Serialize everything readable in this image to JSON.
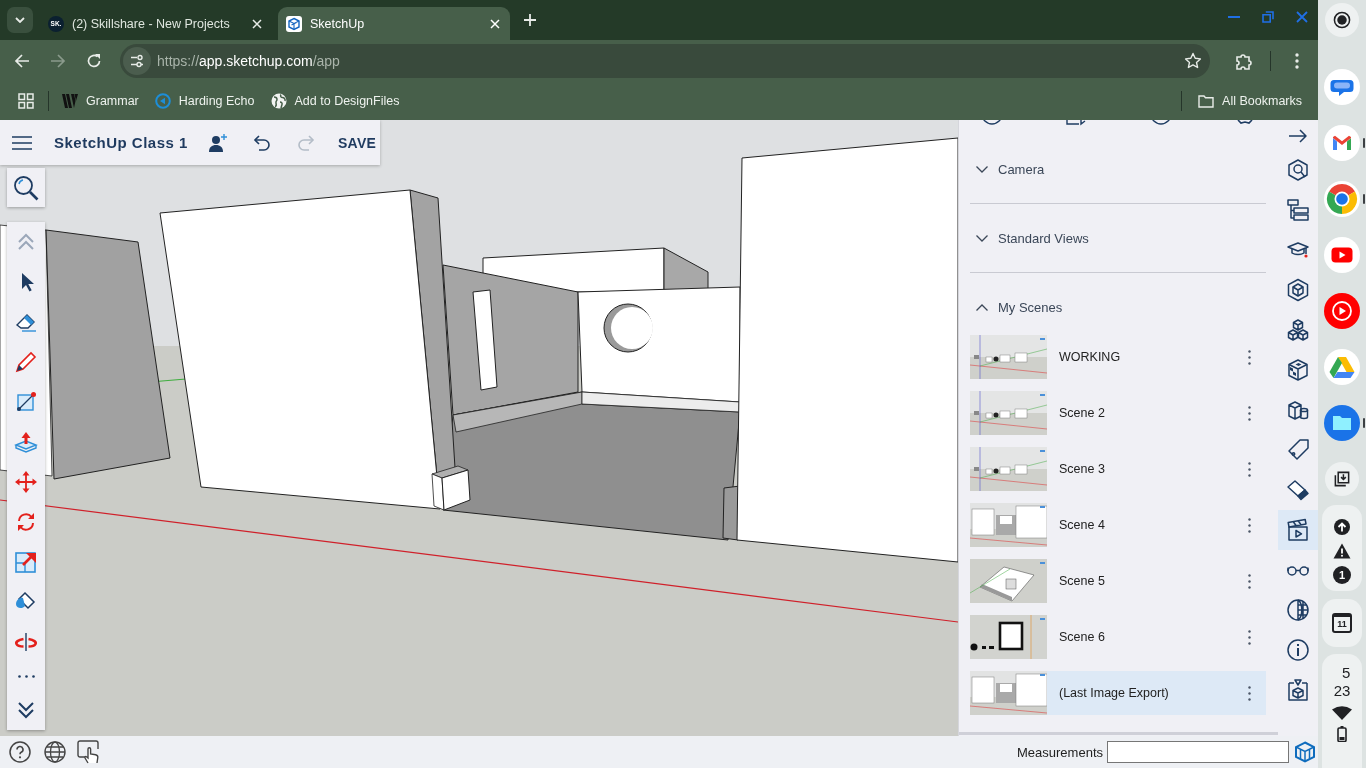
{
  "browser": {
    "tabs": [
      {
        "favicon": "SK.",
        "title": "(2) Skillshare - New Projects",
        "selected": false
      },
      {
        "title": "SketchUp",
        "selected": true
      }
    ],
    "forward_disabled": true,
    "address": {
      "scheme": "https://",
      "host": "app.sketchup.com",
      "path": "/app"
    },
    "bookmarks": [
      {
        "kind": "grammar",
        "label": "Grammar"
      },
      {
        "kind": "echo",
        "label": "Harding Echo"
      },
      {
        "kind": "globe",
        "label": "Add to DesignFiles"
      }
    ],
    "all_bookmarks": "All Bookmarks"
  },
  "app": {
    "title": "SketchUp Class 1",
    "redo_disabled": true,
    "save": "SAVE",
    "tools": [
      {
        "kind": "up",
        "disabled": true
      },
      {
        "kind": "select",
        "disabled": false
      },
      {
        "kind": "eraser",
        "disabled": false
      },
      {
        "kind": "pencil",
        "disabled": false
      },
      {
        "kind": "line",
        "disabled": false
      },
      {
        "kind": "pushpull",
        "disabled": false
      },
      {
        "kind": "move",
        "disabled": false
      },
      {
        "kind": "rotate",
        "disabled": false
      },
      {
        "kind": "scale",
        "disabled": false
      },
      {
        "kind": "paint",
        "disabled": false
      },
      {
        "kind": "orbit",
        "disabled": false
      },
      {
        "kind": "more",
        "disabled": false
      },
      {
        "kind": "down",
        "disabled": false
      }
    ],
    "panel": {
      "sections": [
        {
          "title": "Camera",
          "expanded": false
        },
        {
          "title": "Standard Views",
          "expanded": false
        },
        {
          "title": "My Scenes",
          "expanded": true
        }
      ],
      "scenes": [
        {
          "name": "WORKING",
          "kind": "distant",
          "selected": false
        },
        {
          "name": "Scene 2",
          "kind": "distant",
          "selected": false
        },
        {
          "name": "Scene 3",
          "kind": "distant",
          "selected": false
        },
        {
          "name": "Scene 4",
          "kind": "closeup",
          "selected": false
        },
        {
          "name": "Scene 5",
          "kind": "overhead",
          "selected": false
        },
        {
          "name": "Scene 6",
          "kind": "plan",
          "selected": false
        },
        {
          "name": "(Last Image Export)",
          "kind": "closeup",
          "selected": true
        }
      ]
    },
    "side_icons": [
      {
        "kind": "arrow",
        "selected": false
      },
      {
        "kind": "cubesearch",
        "selected": false
      },
      {
        "kind": "outliner",
        "selected": false
      },
      {
        "kind": "cap",
        "selected": false
      },
      {
        "kind": "hexcube",
        "selected": false
      },
      {
        "kind": "cubes",
        "selected": false
      },
      {
        "kind": "checkcube",
        "selected": false
      },
      {
        "kind": "solids",
        "selected": false
      },
      {
        "kind": "tag",
        "selected": false
      },
      {
        "kind": "styles",
        "selected": false
      },
      {
        "kind": "scenes",
        "selected": true
      },
      {
        "kind": "glasses",
        "selected": false
      },
      {
        "kind": "sphere",
        "selected": false
      },
      {
        "kind": "info",
        "selected": false
      },
      {
        "kind": "export",
        "selected": false
      }
    ],
    "status_bar": {
      "measurements_label": "Measurements"
    }
  },
  "shelf": {
    "apps": [
      {
        "kind": "capture",
        "running": false
      },
      {
        "kind": "messages",
        "running": false
      },
      {
        "kind": "gmail",
        "running": true
      },
      {
        "kind": "chrome",
        "running": true
      },
      {
        "kind": "youtube",
        "running": false
      },
      {
        "kind": "ytmusic",
        "running": false
      },
      {
        "kind": "drive",
        "running": false
      },
      {
        "kind": "files",
        "running": true
      },
      {
        "kind": "holding",
        "running": false
      }
    ],
    "notification_count": "1",
    "calendar_day": "11",
    "time": {
      "hour": "5",
      "minute": "23"
    }
  }
}
